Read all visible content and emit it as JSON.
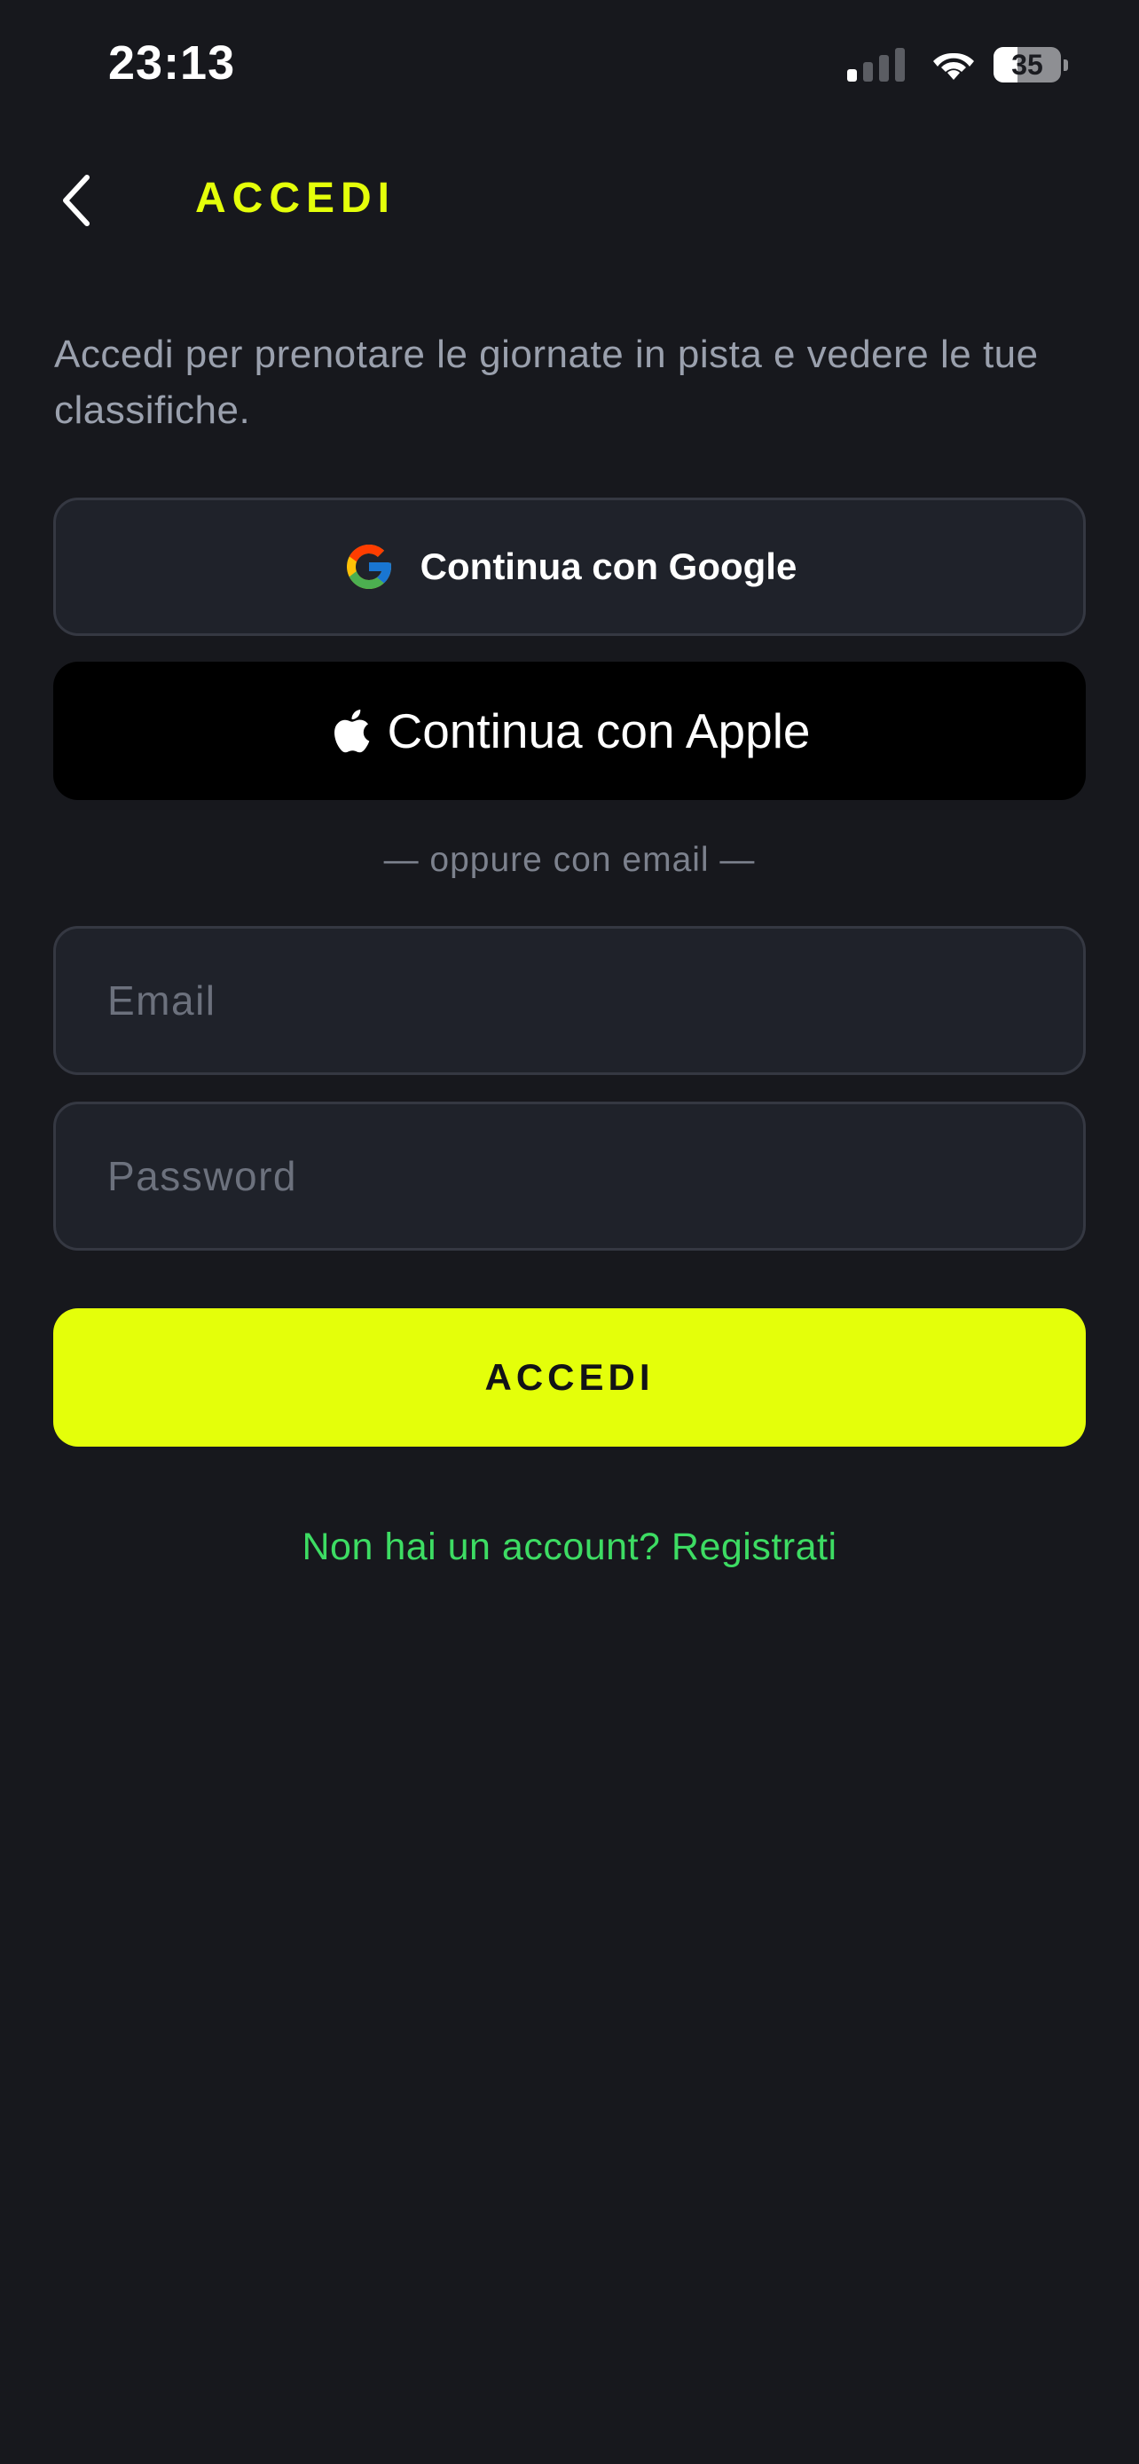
{
  "status_bar": {
    "time": "23:13",
    "battery_level": "35",
    "icons": [
      "cellular-signal-icon",
      "wifi-icon",
      "battery-icon"
    ]
  },
  "header": {
    "back_icon": "chevron-left-icon",
    "title": "ACCEDI"
  },
  "subtitle": "Accedi per prenotare le giornate in pista e vedere le tue classifiche.",
  "social_login": {
    "google_label": "Continua con Google",
    "google_icon": "google-logo-icon",
    "apple_label": "Continua con Apple",
    "apple_icon": "apple-logo-icon"
  },
  "divider": "— oppure con email —",
  "form": {
    "email_placeholder": "Email",
    "email_value": "",
    "password_placeholder": "Password",
    "password_value": "",
    "submit_label": "ACCEDI"
  },
  "register_link": "Non hai un account? Registrati",
  "colors": {
    "background": "#17181d",
    "accent": "#e4ff0a",
    "link": "#3ddc63",
    "surface": "#1f222a",
    "border": "#353842",
    "muted_text": "#9aa0ad"
  }
}
